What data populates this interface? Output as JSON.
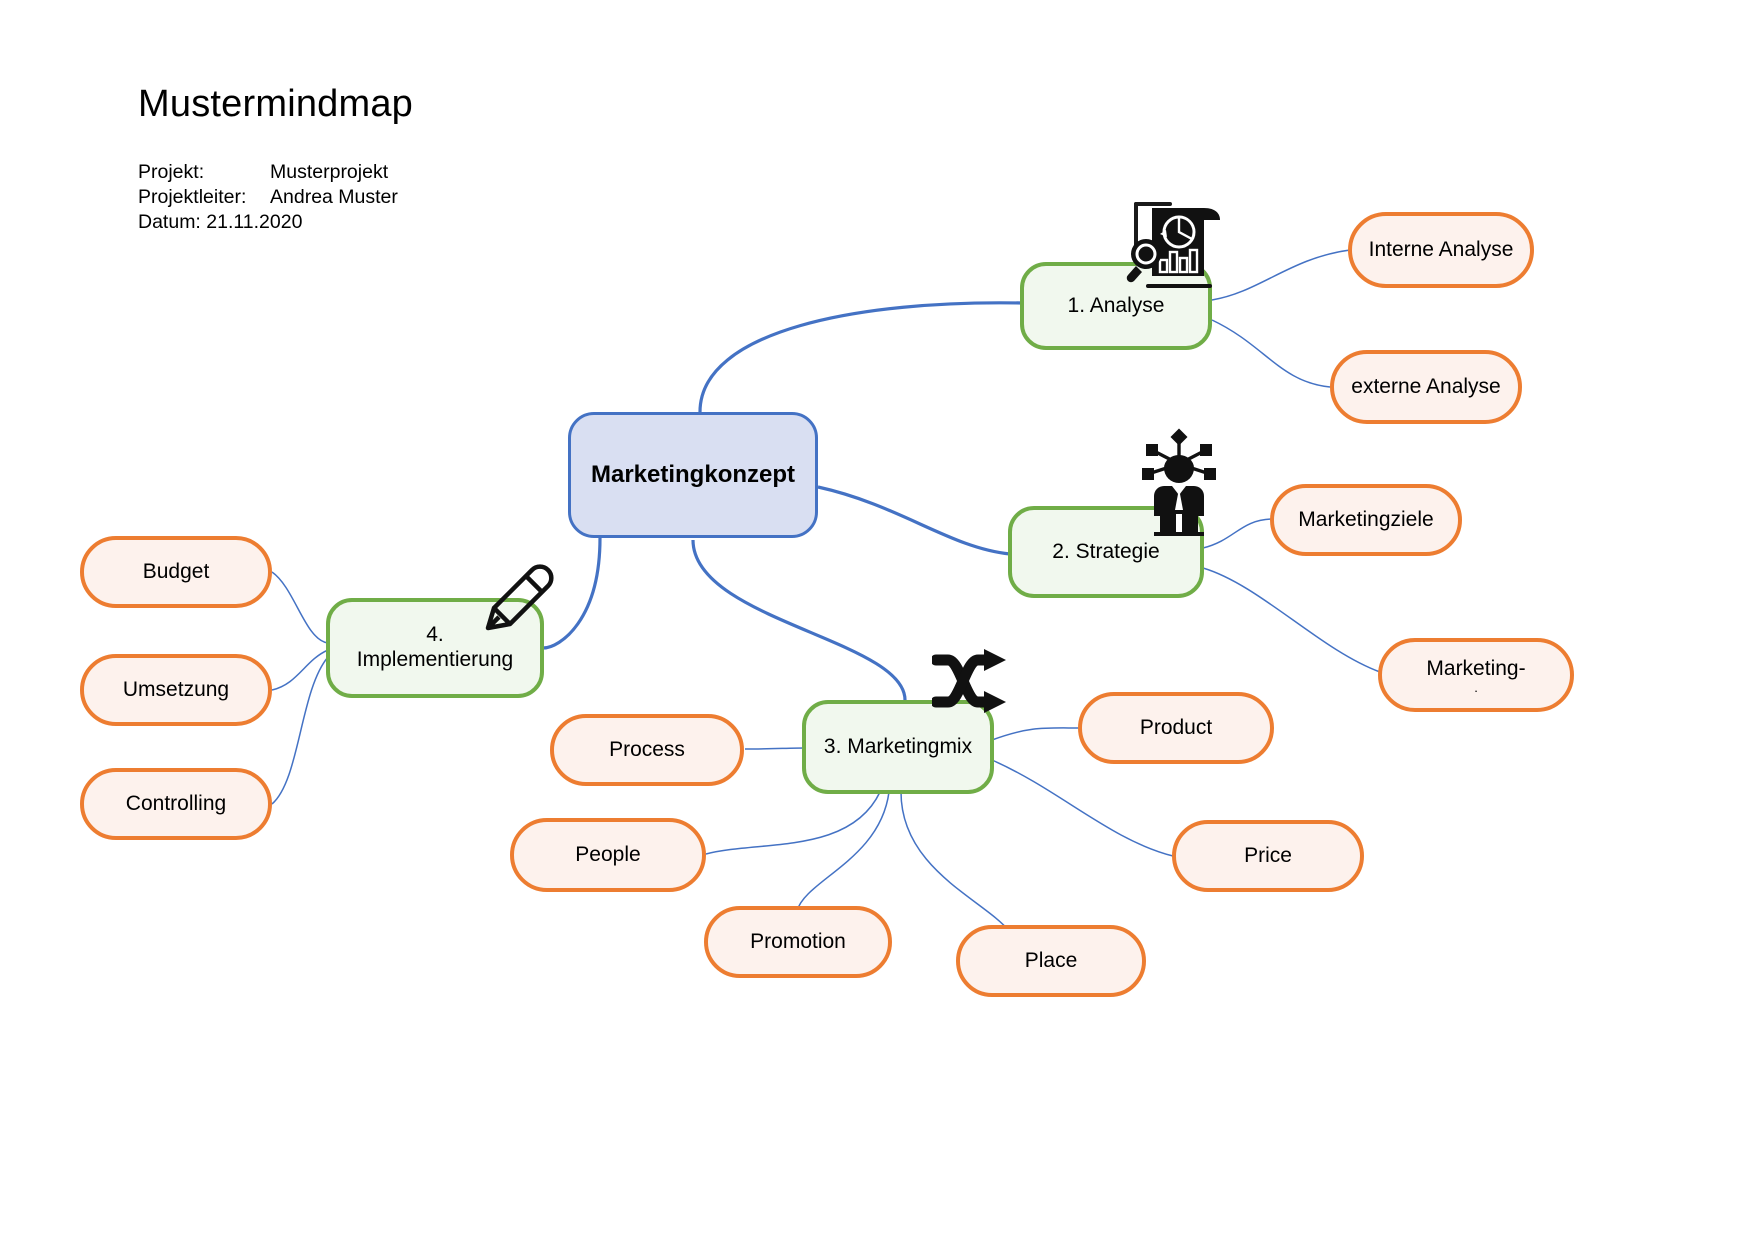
{
  "header": {
    "title": "Mustermindmap",
    "rows": [
      {
        "key": "Projekt:",
        "value": "Musterprojekt"
      },
      {
        "key": "Projektleiter:",
        "value": "Andrea Muster"
      }
    ],
    "date": "Datum: 21.11.2020"
  },
  "colors": {
    "root_fill": "#D9DFF2",
    "root_border": "#4472C4",
    "branch_fill": "#F1F8EE",
    "branch_border": "#70AD47",
    "leaf_fill": "#FDF2ED",
    "leaf_border": "#ED7D31",
    "connector": "#4472C4",
    "icon": "#000000",
    "background": "#FFFFFF"
  },
  "root": {
    "label": "Marketingkonzept"
  },
  "branches": [
    {
      "id": "analyse",
      "label": "1. Analyse",
      "icon": "analysis-report-icon"
    },
    {
      "id": "strategie",
      "label": "2. Strategie",
      "icon": "strategist-network-icon"
    },
    {
      "id": "marketingmix",
      "label": "3. Marketingmix",
      "icon": "shuffle-arrows-icon"
    },
    {
      "id": "implementierung",
      "line1": "4.",
      "line2": "Implementierung",
      "icon": "pencil-icon"
    }
  ],
  "leaves": {
    "analyse": [
      {
        "label": "Interne Analyse"
      },
      {
        "label": "externe Analyse"
      }
    ],
    "strategie": [
      {
        "label": "Marketingziele"
      },
      {
        "label": "Marketing-",
        "sub": "."
      }
    ],
    "marketingmix": [
      {
        "label": "Product"
      },
      {
        "label": "Price"
      },
      {
        "label": "Place"
      },
      {
        "label": "Promotion"
      },
      {
        "label": "People"
      },
      {
        "label": "Process"
      }
    ],
    "implementierung": [
      {
        "label": "Budget"
      },
      {
        "label": "Umsetzung"
      },
      {
        "label": "Controlling"
      }
    ]
  }
}
